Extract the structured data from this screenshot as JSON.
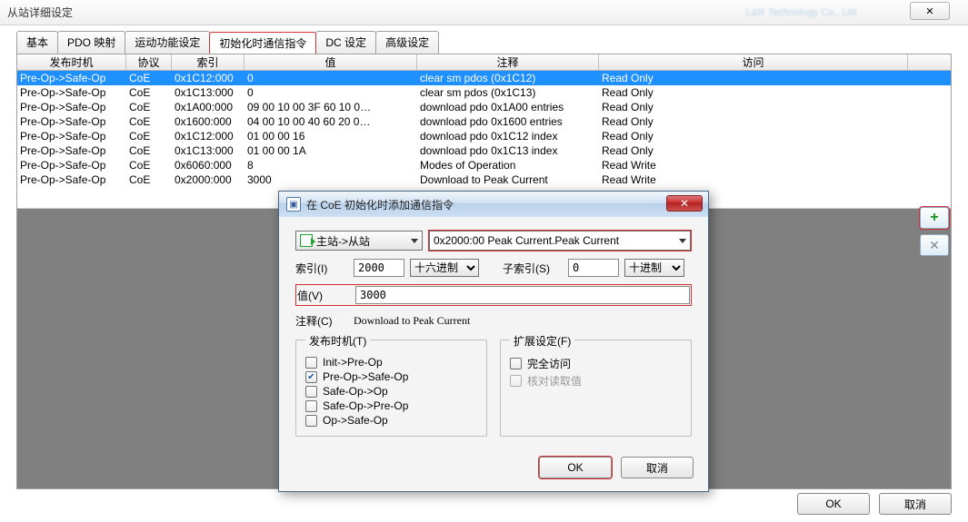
{
  "window": {
    "title": "从站详细设定",
    "faded": "L&R Technology Co., Ltd.",
    "close": "✕"
  },
  "tabs": [
    "基本",
    "PDO 映射",
    "运动功能设定",
    "初始化时通信指令",
    "DC 设定",
    "高级设定"
  ],
  "active_tab": 3,
  "columns": [
    "发布时机",
    "协议",
    "索引",
    "值",
    "注释",
    "访问"
  ],
  "rows": [
    {
      "t": "Pre-Op->Safe-Op",
      "p": "CoE",
      "i": "0x1C12:000",
      "v": "0",
      "c": "clear sm pdos (0x1C12)",
      "a": "Read Only",
      "sel": true
    },
    {
      "t": "Pre-Op->Safe-Op",
      "p": "CoE",
      "i": "0x1C13:000",
      "v": "0",
      "c": "clear sm pdos (0x1C13)",
      "a": "Read Only"
    },
    {
      "t": "Pre-Op->Safe-Op",
      "p": "CoE",
      "i": "0x1A00:000",
      "v": "09 00 10 00 3F 60 10 0…",
      "c": "download pdo 0x1A00 entries",
      "a": "Read Only"
    },
    {
      "t": "Pre-Op->Safe-Op",
      "p": "CoE",
      "i": "0x1600:000",
      "v": "04 00 10 00 40 60 20 0…",
      "c": "download pdo 0x1600 entries",
      "a": "Read Only"
    },
    {
      "t": "Pre-Op->Safe-Op",
      "p": "CoE",
      "i": "0x1C12:000",
      "v": "01 00 00 16",
      "c": "download pdo 0x1C12 index",
      "a": "Read Only"
    },
    {
      "t": "Pre-Op->Safe-Op",
      "p": "CoE",
      "i": "0x1C13:000",
      "v": "01 00 00 1A",
      "c": "download pdo 0x1C13 index",
      "a": "Read Only"
    },
    {
      "t": "Pre-Op->Safe-Op",
      "p": "CoE",
      "i": "0x6060:000",
      "v": "8",
      "c": "Modes of Operation",
      "a": "Read Write"
    },
    {
      "t": "Pre-Op->Safe-Op",
      "p": "CoE",
      "i": "0x2000:000",
      "v": "3000",
      "c": "Download to Peak Current",
      "a": "Read Write"
    }
  ],
  "side": {
    "add": "+",
    "remove": "✕"
  },
  "footer": {
    "ok": "OK",
    "cancel": "取消"
  },
  "popup": {
    "title": "在 CoE 初始化时添加通信指令",
    "station": "主站->从站",
    "object": "0x2000:00   Peak Current.Peak Current",
    "idx_label": "索引(I)",
    "idx_val": "2000",
    "idx_fmt": "十六进制",
    "sub_label": "子索引(S)",
    "sub_val": "0",
    "sub_fmt": "十进制",
    "val_label": "值(V)",
    "val_val": "3000",
    "comment_label": "注释(C)",
    "comment_val": "Download to Peak Current",
    "timing_legend": "发布时机(T)",
    "timing_opts": [
      "Init->Pre-Op",
      "Pre-Op->Safe-Op",
      "Safe-Op->Op",
      "Safe-Op->Pre-Op",
      "Op->Safe-Op"
    ],
    "timing_checked": 1,
    "ext_legend": "扩展设定(F)",
    "ext_opts": [
      "完全访问",
      "核对读取值"
    ],
    "ok": "OK",
    "cancel": "取消"
  }
}
